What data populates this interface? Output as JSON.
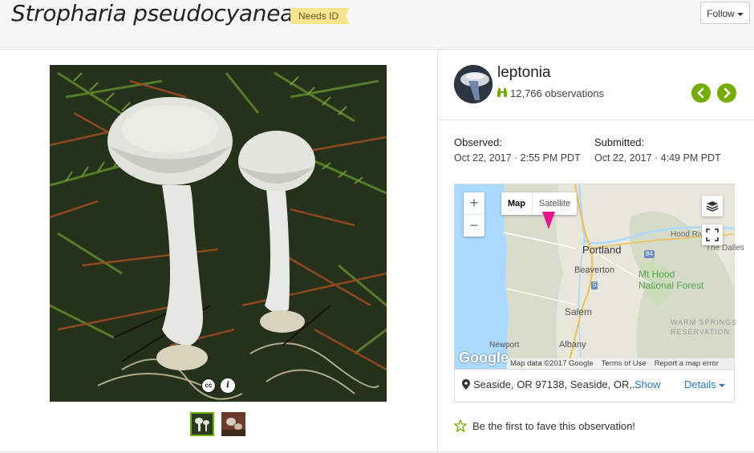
{
  "header": {
    "title": "Stropharia pseudocyanea",
    "quality_badge": "Needs ID",
    "follow_label": "Follow"
  },
  "photo": {
    "license_icon": "cc-icon",
    "info_icon": "info-icon",
    "thumbnails": [
      "thumbnail-1",
      "thumbnail-2"
    ]
  },
  "user": {
    "name": "leptonia",
    "observations": "12,766 observations",
    "prev_icon": "chevron-left-icon",
    "next_icon": "chevron-right-icon"
  },
  "dates": {
    "observed_label": "Observed:",
    "observed_value": "Oct 22, 2017 · 2:55 PM PDT",
    "submitted_label": "Submitted:",
    "submitted_value": "Oct 22, 2017 · 4:49 PM PDT"
  },
  "map": {
    "zoom_in": "+",
    "zoom_out": "−",
    "map_type": "Map",
    "satellite_type": "Satellite",
    "cities": {
      "portland": "Portland",
      "beaverton": "Beaverton",
      "salem": "Salem",
      "albany": "Albany",
      "newport": "Newport",
      "hood_river": "Hood River",
      "the_dalles": "The Dalles"
    },
    "mt_hood": "Mt Hood",
    "national_forest": "National Forest",
    "reservation": "WARM SPRINGS RESERVATION",
    "highway_5": "5",
    "highway_84": "84",
    "google": "Google",
    "map_data": "Map data ©2017 Google",
    "terms": "Terms of Use",
    "report": "Report a map error"
  },
  "location": {
    "text": "Seaside, OR 97138, Seaside, OR,...",
    "show_label": "Show",
    "details_label": "Details"
  },
  "fave": {
    "text": "Be the first to fave this observation!"
  },
  "colors": {
    "accent_green": "#74ac00",
    "link_blue": "#2d7bc0",
    "badge_yellow": "#f7e58f",
    "map_pin": "#e4168f"
  }
}
